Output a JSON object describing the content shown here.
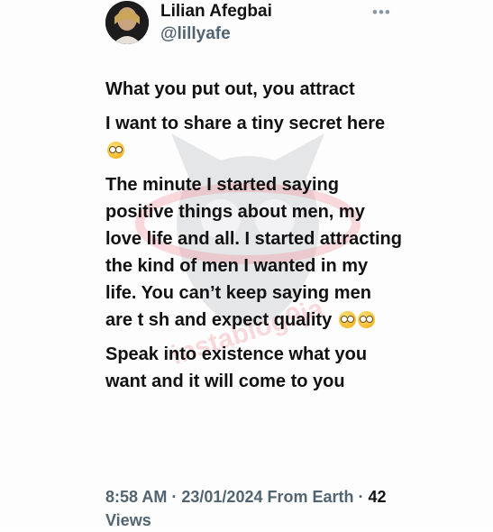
{
  "author": {
    "name": "Lilian Afegbai",
    "handle": "@lillyafe",
    "more_icon": "more-dots-icon"
  },
  "tweet": {
    "paragraphs": [
      "What you put out, you attract",
      "I want to share a tiny secret here",
      "The minute I started saying positive things about men, my love life and all. I started attracting the kind of men I wanted in my life. You can’t keep saying men are t sh and expect quality",
      "Speak into existence what you want and it will come to you"
    ],
    "emoji_name": "rolling-eyes-emoji"
  },
  "meta": {
    "time": "8:58 AM",
    "date": "23/01/2024",
    "source": "From Earth",
    "views_count": "42",
    "views_label": "Views",
    "separator": "·"
  },
  "watermark": {
    "text": "instablog9ja",
    "accent_color": "#e8404f"
  },
  "colors": {
    "text_primary": "#0f1419",
    "text_secondary": "#536471"
  }
}
